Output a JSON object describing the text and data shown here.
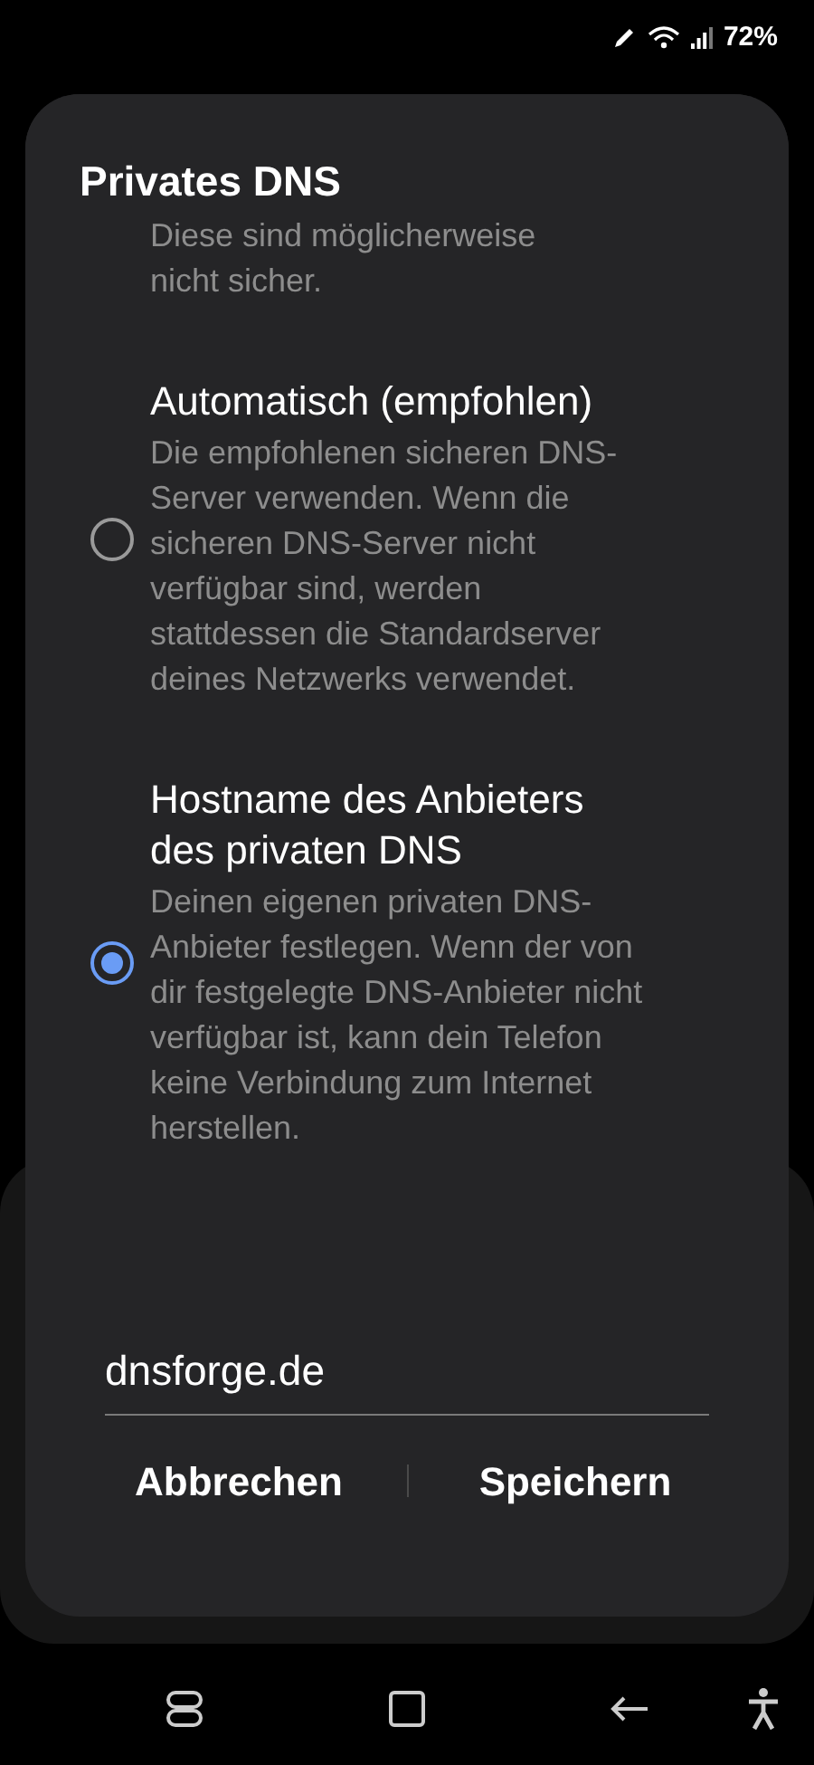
{
  "status_bar": {
    "battery": "72%"
  },
  "dialog": {
    "title": "Privates DNS",
    "options": [
      {
        "kind": "partial",
        "description": "Diese sind möglicherweise nicht sicher."
      },
      {
        "kind": "full",
        "title": "Automatisch (empfohlen)",
        "description": "Die empfohlenen sicheren DNS-Server verwenden. Wenn die sicheren DNS-Server nicht verfügbar sind, werden stattdessen die Standardserver deines Netzwerks verwendet.",
        "selected": false
      },
      {
        "kind": "full",
        "title": "Hostname des Anbieters des privaten DNS",
        "description": "Deinen eigenen privaten DNS-Anbieter festlegen. Wenn der von dir festgelegte DNS-Anbieter nicht verfügbar ist, kann dein Telefon keine Verbindung zum Internet herstellen.",
        "selected": true
      }
    ],
    "hostname": "dnsforge.de",
    "buttons": [
      "Abbrechen",
      "Speichern"
    ]
  }
}
